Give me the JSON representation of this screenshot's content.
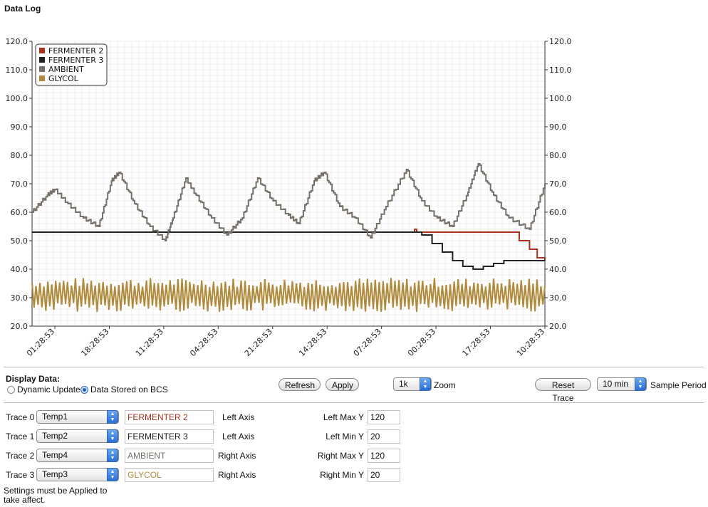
{
  "page": {
    "title": "Data Log"
  },
  "colors": {
    "fermenter2": "#a8321f",
    "fermenter3": "#222222",
    "ambient": "#777068",
    "glycol": "#b08a3a",
    "grid": "#e3e3e3"
  },
  "chart_data": {
    "type": "line",
    "title": "",
    "y_ticks": [
      "120.0",
      "110.0",
      "100.0",
      "90.0",
      "80.0",
      "70.0",
      "60.0",
      "50.0",
      "40.0",
      "30.0",
      "20.0"
    ],
    "ylim": [
      20,
      120
    ],
    "right_ylim": [
      20,
      120
    ],
    "x_ticks": [
      "01:28:53",
      "18:28:53",
      "11:28:53",
      "04:28:53",
      "21:28:53",
      "14:28:53",
      "07:28:53",
      "00:28:53",
      "17:28:53",
      "10:28:53"
    ],
    "grid": true,
    "legend_position": "top-left",
    "series": [
      {
        "name": "FERMENTER 2",
        "color": "#a8321f",
        "axis": "left",
        "points": [
          [
            0,
            53
          ],
          [
            0.746,
            53
          ],
          [
            0.746,
            54
          ],
          [
            0.75,
            53
          ],
          [
            0.93,
            53
          ],
          [
            0.95,
            50
          ],
          [
            0.97,
            47
          ],
          [
            0.985,
            44
          ],
          [
            1,
            43
          ]
        ]
      },
      {
        "name": "FERMENTER 3",
        "color": "#222222",
        "axis": "left",
        "points": [
          [
            0,
            53
          ],
          [
            0.746,
            53
          ],
          [
            0.76,
            52
          ],
          [
            0.78,
            49
          ],
          [
            0.8,
            46
          ],
          [
            0.82,
            43
          ],
          [
            0.84,
            41
          ],
          [
            0.86,
            40
          ],
          [
            0.88,
            41
          ],
          [
            0.9,
            42
          ],
          [
            0.92,
            43
          ],
          [
            1,
            43
          ]
        ]
      },
      {
        "name": "AMBIENT",
        "color": "#777068",
        "axis": "right",
        "points": [
          [
            0,
            60
          ],
          [
            0.03,
            66
          ],
          [
            0.045,
            68
          ],
          [
            0.07,
            63
          ],
          [
            0.1,
            58
          ],
          [
            0.13,
            55
          ],
          [
            0.155,
            71
          ],
          [
            0.17,
            74
          ],
          [
            0.2,
            63
          ],
          [
            0.23,
            55
          ],
          [
            0.26,
            50
          ],
          [
            0.275,
            58
          ],
          [
            0.3,
            72
          ],
          [
            0.32,
            66
          ],
          [
            0.35,
            58
          ],
          [
            0.38,
            52
          ],
          [
            0.41,
            58
          ],
          [
            0.44,
            72
          ],
          [
            0.47,
            64
          ],
          [
            0.5,
            59
          ],
          [
            0.52,
            56
          ],
          [
            0.55,
            71
          ],
          [
            0.57,
            74
          ],
          [
            0.6,
            62
          ],
          [
            0.63,
            58
          ],
          [
            0.66,
            51
          ],
          [
            0.69,
            62
          ],
          [
            0.73,
            75
          ],
          [
            0.76,
            64
          ],
          [
            0.79,
            58
          ],
          [
            0.82,
            55
          ],
          [
            0.85,
            67
          ],
          [
            0.87,
            77
          ],
          [
            0.9,
            66
          ],
          [
            0.93,
            58
          ],
          [
            0.97,
            54
          ],
          [
            1,
            70
          ]
        ]
      },
      {
        "name": "GLYCOL",
        "color": "#b08a3a",
        "axis": "right",
        "points": [
          [
            0,
            30
          ],
          [
            1,
            30
          ]
        ],
        "oscillation": [
          25,
          37
        ]
      }
    ]
  },
  "display": {
    "heading": "Display Data:",
    "dynamic_label": "Dynamic Update",
    "stored_label": "Data Stored on BCS",
    "refresh": "Refresh",
    "apply": "Apply",
    "zoom_value": "1k",
    "zoom_label": "Zoom",
    "reset_trace": "Reset Trace",
    "sample_value": "10 min",
    "sample_label": "Sample Period"
  },
  "traces": [
    {
      "label": "Trace 0",
      "temp": "Temp1",
      "name": "FERMENTER 2",
      "axis": "Left Axis",
      "color": "#a8321f"
    },
    {
      "label": "Trace 1",
      "temp": "Temp2",
      "name": "FERMENTER 3",
      "axis": "Left Axis",
      "color": "#222222"
    },
    {
      "label": "Trace 2",
      "temp": "Temp4",
      "name": "AMBIENT",
      "axis": "Right Axis",
      "color": "#777068"
    },
    {
      "label": "Trace 3",
      "temp": "Temp3",
      "name": "GLYCOL",
      "axis": "Right Axis",
      "color": "#b08a3a"
    }
  ],
  "limits": [
    {
      "label": "Left Max Y",
      "value": "120"
    },
    {
      "label": "Left Min Y",
      "value": "20"
    },
    {
      "label": "Right Max Y",
      "value": "120"
    },
    {
      "label": "Right Min Y",
      "value": "20"
    }
  ],
  "note": "Settings must be Applied to take affect."
}
